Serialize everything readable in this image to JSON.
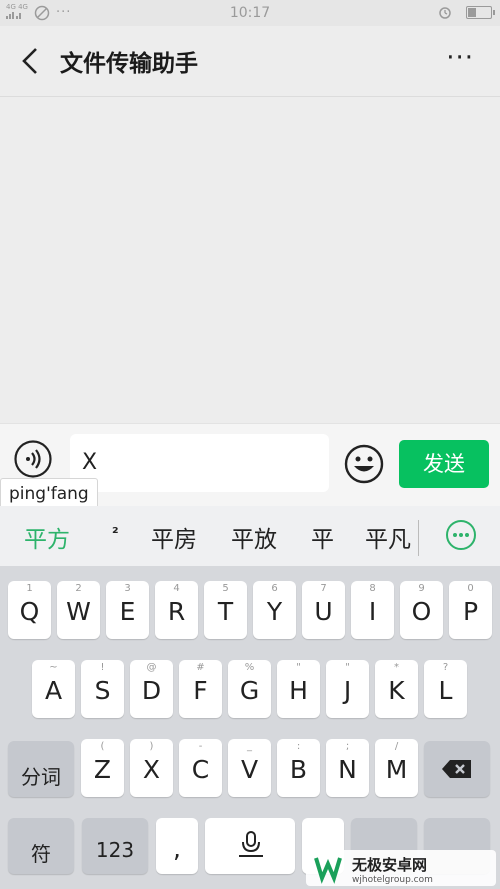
{
  "status": {
    "time": "10:17",
    "network": "4G 4G",
    "icons": [
      "signal-icon",
      "wifi-off-icon",
      "more-dots-icon",
      "alarm-icon",
      "battery-icon"
    ]
  },
  "header": {
    "title": "文件传输助手",
    "back_icon": "chevron-left-icon",
    "more_label": "···"
  },
  "input": {
    "value": "X",
    "send_label": "发送"
  },
  "ime": {
    "pinyin": "ping'fang",
    "candidates": [
      "平方",
      "²",
      "平房",
      "平放",
      "平",
      "平凡"
    ]
  },
  "keyboard": {
    "row1": [
      {
        "k": "Q",
        "h": "1"
      },
      {
        "k": "W",
        "h": "2"
      },
      {
        "k": "E",
        "h": "3"
      },
      {
        "k": "R",
        "h": "4"
      },
      {
        "k": "T",
        "h": "5"
      },
      {
        "k": "Y",
        "h": "6"
      },
      {
        "k": "U",
        "h": "7"
      },
      {
        "k": "I",
        "h": "8"
      },
      {
        "k": "O",
        "h": "9"
      },
      {
        "k": "P",
        "h": "0"
      }
    ],
    "row2": [
      {
        "k": "A",
        "h": "~"
      },
      {
        "k": "S",
        "h": "!"
      },
      {
        "k": "D",
        "h": "@"
      },
      {
        "k": "F",
        "h": "#"
      },
      {
        "k": "G",
        "h": "%"
      },
      {
        "k": "H",
        "h": "\""
      },
      {
        "k": "J",
        "h": "\""
      },
      {
        "k": "K",
        "h": "*"
      },
      {
        "k": "L",
        "h": "?"
      }
    ],
    "row3": [
      {
        "k": "Z",
        "h": "("
      },
      {
        "k": "X",
        "h": ")"
      },
      {
        "k": "C",
        "h": "-"
      },
      {
        "k": "V",
        "h": "_"
      },
      {
        "k": "B",
        "h": ":"
      },
      {
        "k": "N",
        "h": ";"
      },
      {
        "k": "M",
        "h": "/"
      }
    ],
    "segment_label": "分词",
    "symbol_label": "符",
    "num_label": "123",
    "comma_label": ","
  },
  "colors": {
    "accent": "#07c160",
    "candidate_highlight": "#2db36b"
  }
}
